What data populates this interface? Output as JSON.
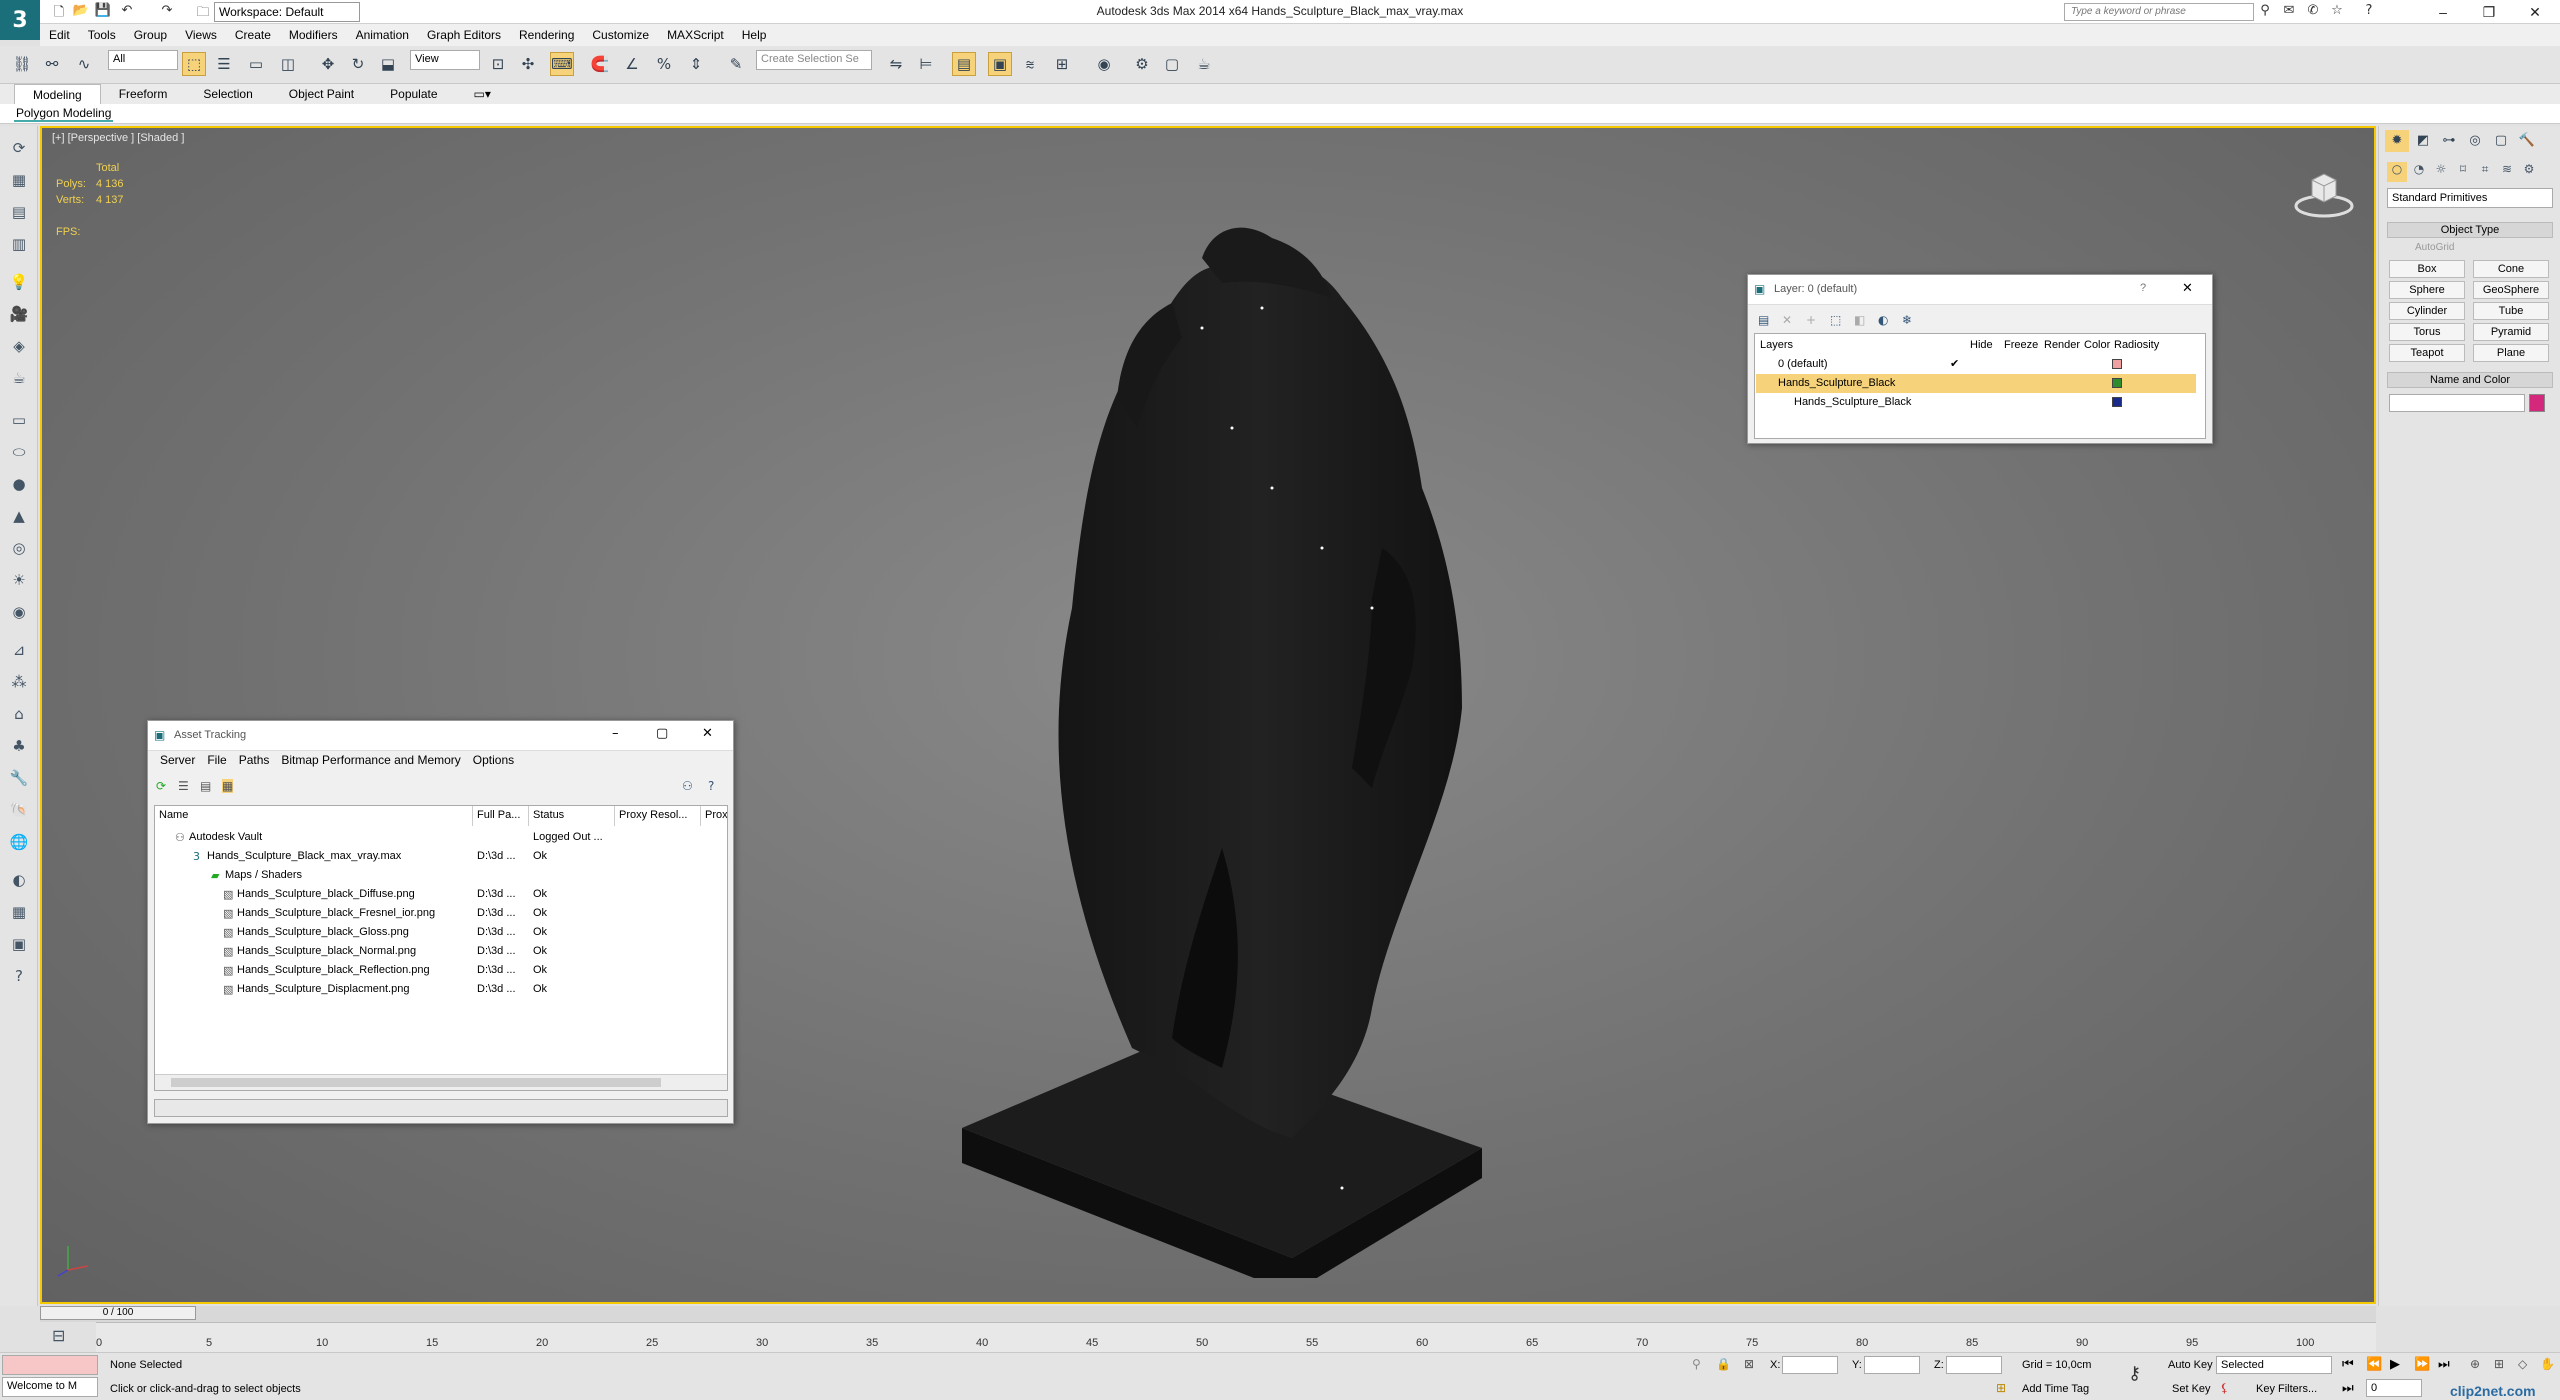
{
  "app": {
    "title": "Autodesk 3ds Max  2014 x64     Hands_Sculpture_Black_max_vray.max",
    "workspace": "Workspace: Default",
    "search_placeholder": "Type a keyword or phrase",
    "logo": "3"
  },
  "menu": [
    "Edit",
    "Tools",
    "Group",
    "Views",
    "Create",
    "Modifiers",
    "Animation",
    "Graph Editors",
    "Rendering",
    "Customize",
    "MAXScript",
    "Help"
  ],
  "toolbar": {
    "selection_filter": "All",
    "ref_coord": "View",
    "named_selection": "Create Selection Se"
  },
  "ribbon": {
    "tabs": [
      "Modeling",
      "Freeform",
      "Selection",
      "Object Paint",
      "Populate"
    ],
    "sub_label": "Polygon Modeling"
  },
  "viewport": {
    "label": "[+] [Perspective ] [Shaded ]",
    "stats_total": "Total",
    "polys_label": "Polys:",
    "polys_value": "4 136",
    "verts_label": "Verts:",
    "verts_value": "4 137",
    "fps_label": "FPS:"
  },
  "command_panel": {
    "dropdown": "Standard Primitives",
    "object_type_title": "Object Type",
    "autogrid": "AutoGrid",
    "buttons": [
      "Box",
      "Cone",
      "Sphere",
      "GeoSphere",
      "Cylinder",
      "Tube",
      "Torus",
      "Pyramid",
      "Teapot",
      "Plane"
    ],
    "name_color_title": "Name and Color",
    "name_value": "",
    "color": "#d4287c"
  },
  "layer_window": {
    "title": "Layer: 0 (default)",
    "help": "?",
    "columns": [
      "Layers",
      "Hide",
      "Freeze",
      "Render",
      "Color",
      "Radiosity"
    ],
    "rows": [
      {
        "name": "0 (default)",
        "color": "#f0a0a0"
      },
      {
        "name": "Hands_Sculpture_Black",
        "color": "#2e8b2e"
      },
      {
        "name": "Hands_Sculpture_Black",
        "color": "#1a2a8a"
      }
    ]
  },
  "asset_window": {
    "title": "Asset Tracking",
    "menu": [
      "Server",
      "File",
      "Paths",
      "Bitmap Performance and Memory",
      "Options"
    ],
    "columns": [
      "Name",
      "Full Pa...",
      "Status",
      "Proxy Resol...",
      "Prox"
    ],
    "rows": [
      {
        "name": "Autodesk Vault",
        "path": "",
        "status": "Logged Out ..."
      },
      {
        "name": "Hands_Sculpture_Black_max_vray.max",
        "path": "D:\\3d ...",
        "status": "Ok"
      },
      {
        "name": "Maps / Shaders",
        "path": "",
        "status": ""
      },
      {
        "name": "Hands_Sculpture_black_Diffuse.png",
        "path": "D:\\3d ...",
        "status": "Ok"
      },
      {
        "name": "Hands_Sculpture_black_Fresnel_ior.png",
        "path": "D:\\3d ...",
        "status": "Ok"
      },
      {
        "name": "Hands_Sculpture_black_Gloss.png",
        "path": "D:\\3d ...",
        "status": "Ok"
      },
      {
        "name": "Hands_Sculpture_black_Normal.png",
        "path": "D:\\3d ...",
        "status": "Ok"
      },
      {
        "name": "Hands_Sculpture_black_Reflection.png",
        "path": "D:\\3d ...",
        "status": "Ok"
      },
      {
        "name": "Hands_Sculpture_Displacment.png",
        "path": "D:\\3d ...",
        "status": "Ok"
      }
    ]
  },
  "timeline": {
    "slider_label": "0 / 100",
    "ticks": [
      "0",
      "5",
      "10",
      "15",
      "20",
      "25",
      "30",
      "35",
      "40",
      "45",
      "50",
      "55",
      "60",
      "65",
      "70",
      "75",
      "80",
      "85",
      "90",
      "95",
      "100"
    ]
  },
  "status": {
    "maxscript": "Welcome to M",
    "selection": "None Selected",
    "prompt": "Click or click-and-drag to select objects",
    "x_label": "X:",
    "y_label": "Y:",
    "z_label": "Z:",
    "grid": "Grid = 10,0cm",
    "add_time_tag": "Add Time Tag",
    "auto_key": "Auto Key",
    "set_key": "Set Key",
    "selected": "Selected",
    "key_filters": "Key Filters...",
    "frame": "0",
    "watermark": "clip2net.com"
  }
}
